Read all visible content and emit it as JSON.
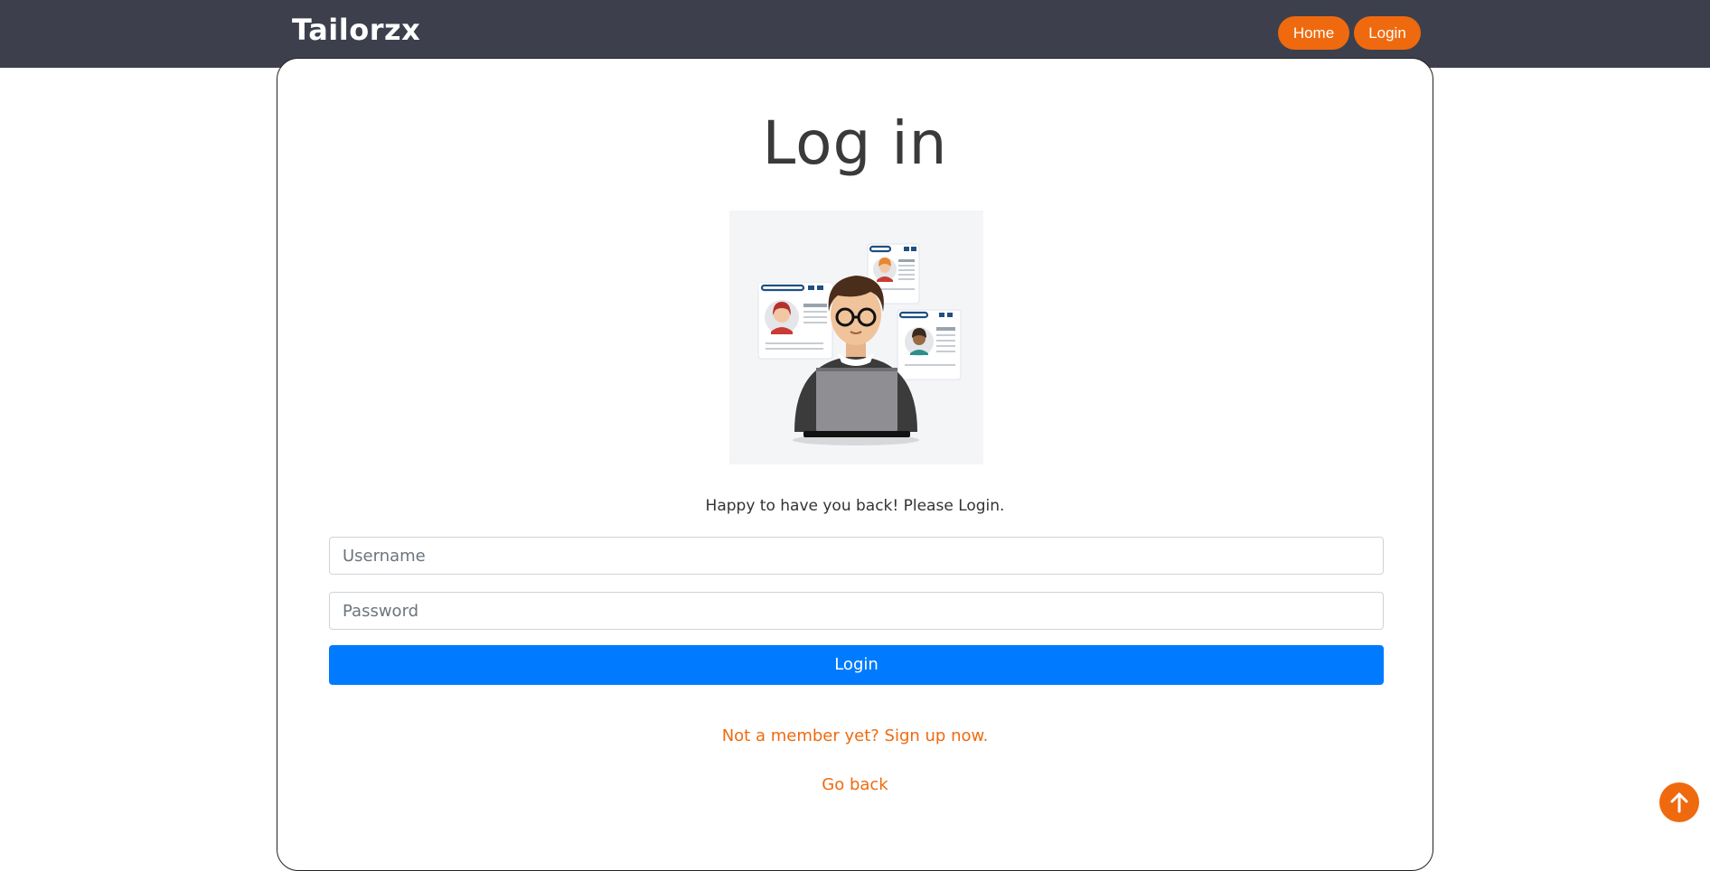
{
  "navbar": {
    "brand": "Tailorzx",
    "links": [
      {
        "label": "Home"
      },
      {
        "label": "Login"
      }
    ]
  },
  "main": {
    "title": "Log in",
    "subtitle": "Happy to have you back! Please Login.",
    "username_placeholder": "Username",
    "password_placeholder": "Password",
    "login_button": "Login",
    "signup_link": "Not a member yet? Sign up now.",
    "goback_link": "Go back"
  },
  "scroll_top": {
    "icon": "arrow-up-icon"
  },
  "colors": {
    "navbar_bg": "#3d404c",
    "accent": "#ef6a0e",
    "primary_button": "#007bff",
    "card_border": "#222222"
  }
}
